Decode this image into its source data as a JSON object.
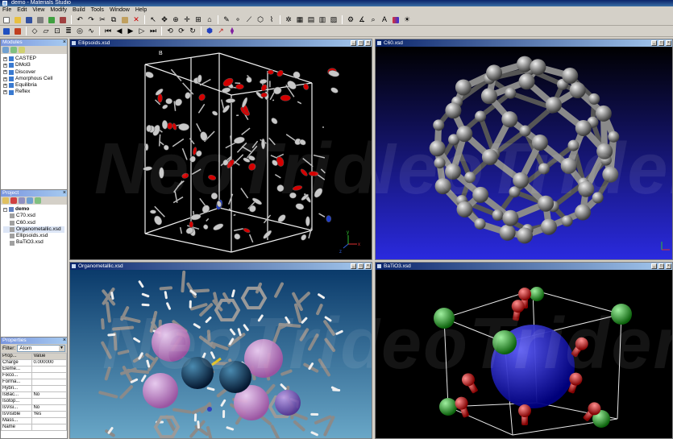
{
  "window": {
    "title": "demo - Materials Studio"
  },
  "menu": [
    "File",
    "Edit",
    "View",
    "Modify",
    "Build",
    "Tools",
    "Window",
    "Help"
  ],
  "modules": {
    "title": "Modules",
    "items": [
      "CASTEP",
      "DMol3",
      "Discover",
      "Amorphous Cell",
      "Equilibria",
      "Reflex"
    ]
  },
  "project": {
    "title": "Project",
    "root": "demo",
    "files": [
      "C70.xsd",
      "C60.xsd",
      "Organometallic.xsd",
      "Ellipsoids.xsd",
      "BaTiO3.xsd"
    ]
  },
  "properties": {
    "title": "Properties",
    "filter_label": "Filter:",
    "filter_value": "Atom",
    "columns": [
      "Prop...",
      "Value"
    ],
    "rows": [
      [
        "Charge",
        "0.000000"
      ],
      [
        "Eleme...",
        ""
      ],
      [
        "Fixco...",
        ""
      ],
      [
        "Forma...",
        ""
      ],
      [
        "Hybri...",
        ""
      ],
      [
        "IsBac...",
        "No"
      ],
      [
        "Isotop...",
        ""
      ],
      [
        "IsVisi...",
        "No"
      ],
      [
        "IsVisible",
        "Yes"
      ],
      [
        "Mass...",
        ""
      ],
      [
        "Name",
        ""
      ]
    ]
  },
  "documents": [
    {
      "title": "Ellipsoids.xsd",
      "axis_x": "x",
      "axis_y": "y",
      "axis_z": "z"
    },
    {
      "title": "C60.xsd"
    },
    {
      "title": "Organometallic.xsd"
    },
    {
      "title": "BaTiO3.xsd"
    }
  ],
  "cell_label": "B",
  "watermark": "NeoTrident",
  "colors": {
    "title_active": "#0a246a",
    "oxygen": "#d40000",
    "nitrogen": "#1e3cc8",
    "carbon": "#c8c8c8",
    "c60_bg_top": "#2b2bd8",
    "metal": "#1a4a6a",
    "green_atom": "#1fa81f",
    "pink_atom": "#d890d8"
  }
}
